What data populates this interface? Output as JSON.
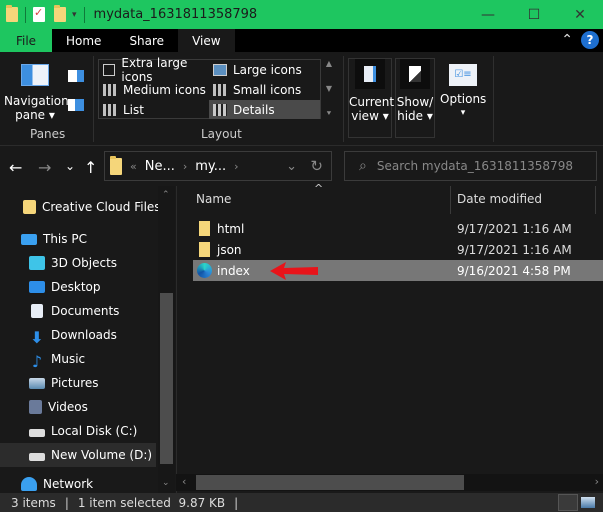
{
  "window": {
    "title": "mydata_1631811358798",
    "controls": {
      "minimize": "—",
      "maximize": "☐",
      "close": "✕"
    }
  },
  "quick_access": {
    "dropdown_icon": "▾"
  },
  "tabs": [
    {
      "label": "File"
    },
    {
      "label": "Home"
    },
    {
      "label": "Share"
    },
    {
      "label": "View",
      "active": true
    }
  ],
  "tabbar_right": {
    "collapse_icon": "⌃",
    "help_icon": "?"
  },
  "ribbon": {
    "panes": {
      "navigation_pane_label": "Navigation pane ▾",
      "group_label": "Panes"
    },
    "layout": {
      "group_label": "Layout",
      "items": [
        {
          "label": "Extra large icons"
        },
        {
          "label": "Large icons"
        },
        {
          "label": "Medium icons"
        },
        {
          "label": "Small icons"
        },
        {
          "label": "List"
        },
        {
          "label": "Details",
          "selected": true
        }
      ]
    },
    "current_view": {
      "label": "Current view ▾"
    },
    "show_hide": {
      "label": "Show/ hide ▾"
    },
    "options": {
      "label": "Options",
      "dropdown": "▾"
    }
  },
  "address": {
    "back": "←",
    "forward": "→",
    "recent": "⌄",
    "up": "↑",
    "overflow": "«",
    "crumbs": [
      "Ne...",
      "my..."
    ],
    "crumb_separator": "›",
    "dropdown": "⌄",
    "refresh": "↻"
  },
  "search": {
    "placeholder": "Search mydata_1631811358798",
    "icon": "⌕"
  },
  "sidebar": {
    "items": [
      {
        "label": "Creative Cloud Files",
        "icon": "creative-cloud-icon"
      },
      {
        "label": "This PC",
        "icon": "computer-icon"
      },
      {
        "label": "3D Objects",
        "icon": "3d-objects-icon"
      },
      {
        "label": "Desktop",
        "icon": "desktop-icon"
      },
      {
        "label": "Documents",
        "icon": "documents-icon"
      },
      {
        "label": "Downloads",
        "icon": "download-icon"
      },
      {
        "label": "Music",
        "icon": "music-icon"
      },
      {
        "label": "Pictures",
        "icon": "pictures-icon"
      },
      {
        "label": "Videos",
        "icon": "videos-icon"
      },
      {
        "label": "Local Disk (C:)",
        "icon": "drive-icon"
      },
      {
        "label": "New Volume (D:)",
        "icon": "drive-icon",
        "selected": true
      },
      {
        "label": "Network",
        "icon": "network-icon"
      }
    ]
  },
  "file_list": {
    "columns": [
      {
        "label": "Name"
      },
      {
        "label": "Date modified"
      }
    ],
    "sort_indicator": "^",
    "rows": [
      {
        "name": "html",
        "date": "9/17/2021 1:16 AM",
        "type": "folder"
      },
      {
        "name": "json",
        "date": "9/17/2021 1:16 AM",
        "type": "folder"
      },
      {
        "name": "index",
        "date": "9/16/2021 4:58 PM",
        "type": "edge-html",
        "selected": true
      }
    ]
  },
  "annotation": {
    "arrow_color": "#e8141a"
  },
  "status": {
    "items": "3 items",
    "separator": "|",
    "selection": "1 item selected  9.87 KB"
  },
  "colors": {
    "accent": "#1ec660",
    "background": "#191919",
    "selected_row": "#777777"
  }
}
